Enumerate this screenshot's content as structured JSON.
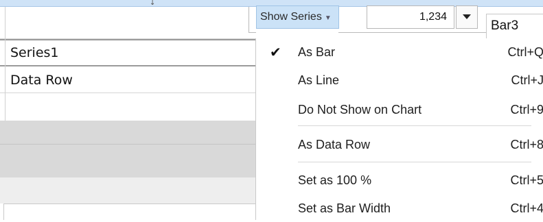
{
  "sheet": {
    "header_mark": "↓",
    "rows": [
      {
        "label": "Series1"
      },
      {
        "label": "Data Row"
      }
    ]
  },
  "toolbar": {
    "show_series_label": "Show Series",
    "value": "1,234",
    "bar3_label": "Bar3"
  },
  "menu": {
    "items": [
      {
        "label": "As Bar",
        "shortcut": "Ctrl+Q",
        "checked": true
      },
      {
        "label": "As Line",
        "shortcut": "Ctrl+J",
        "checked": false
      },
      {
        "label": "Do Not Show on Chart",
        "shortcut": "Ctrl+9",
        "checked": false
      },
      {
        "label": "As Data Row",
        "shortcut": "Ctrl+8",
        "checked": false
      },
      {
        "label": "Set as 100 %",
        "shortcut": "Ctrl+5",
        "checked": false
      },
      {
        "label": "Set as Bar Width",
        "shortcut": "Ctrl+4",
        "checked": false
      }
    ]
  },
  "colors": {
    "header_band": "#cfe3f7",
    "button_bg": "#cbe2f7",
    "gray_band": "#d9d9d9"
  }
}
